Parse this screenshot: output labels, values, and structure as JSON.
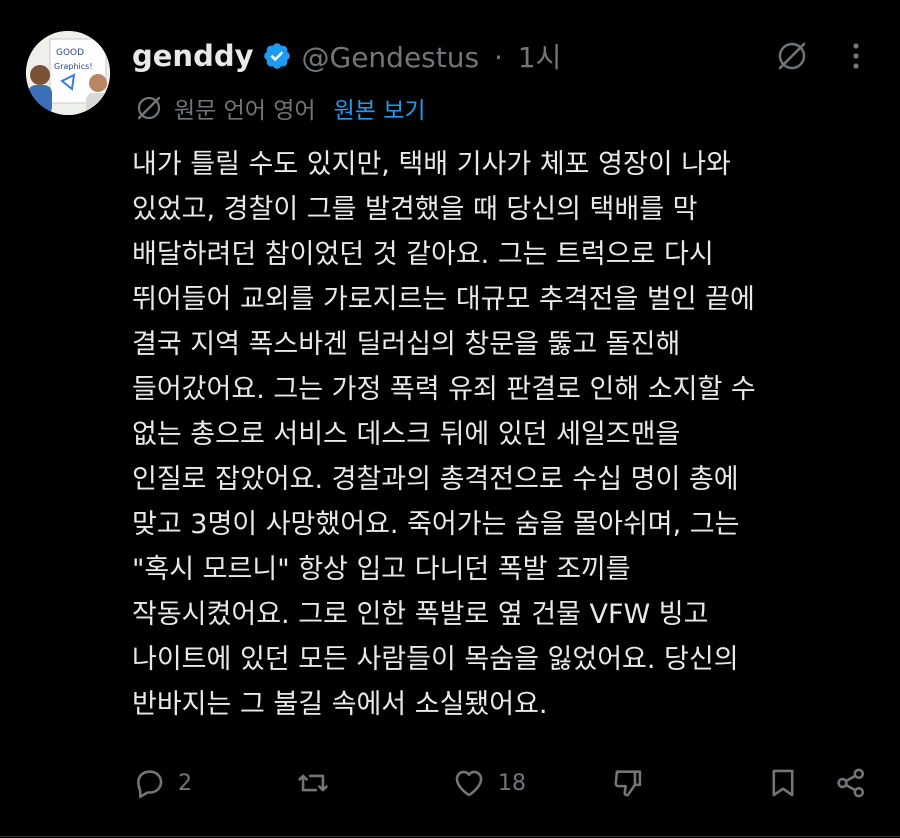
{
  "post": {
    "author_name": "genddy",
    "handle": "@Gendestus",
    "separator": "·",
    "time": "1시",
    "translation_note": "원문 언어 영어",
    "view_original": "원본 보기",
    "body": "내가 틀릴 수도 있지만, 택배 기사가 체포 영장이 나와\n있었고, 경찰이 그를 발견했을 때 당신의 택배를 막\n배달하려던 참이었던 것 같아요. 그는 트럭으로 다시\n뛰어들어 교외를 가로지르는 대규모 추격전을 벌인 끝에\n결국 지역 폭스바겐 딜러십의 창문을 뚫고 돌진해\n들어갔어요. 그는 가정 폭력 유죄 판결로 인해 소지할 수\n없는 총으로 서비스 데스크 뒤에 있던 세일즈맨을\n인질로 잡았어요. 경찰과의 총격전으로 수십 명이 총에\n맞고 3명이 사망했어요. 죽어가는 숨을 몰아쉬며, 그는\n\"혹시 모르니\" 항상 입고 다니던 폭발 조끼를\n작동시켰어요. 그로 인한 폭발로 옆 건물 VFW 빙고\n나이트에 있던 모든 사람들이 목숨을 잃었어요. 당신의\n반바지는 그 불길 속에서 소실됐어요.",
    "avatar_sign_lines": [
      "GOOD",
      "Graphics!"
    ]
  },
  "actions": {
    "replies": "2",
    "likes": "18"
  },
  "colors": {
    "background": "#000000",
    "text": "#e7e9ea",
    "muted": "#71767b",
    "accent": "#1d9bf0"
  },
  "icons": {
    "verified": "verified-badge-icon",
    "grok": "grok-icon",
    "more": "more-icon",
    "translate": "translate-icon",
    "reply": "reply-icon",
    "retweet": "retweet-icon",
    "like": "like-icon",
    "dislike": "dislike-icon",
    "bookmark": "bookmark-icon",
    "share": "share-icon"
  }
}
